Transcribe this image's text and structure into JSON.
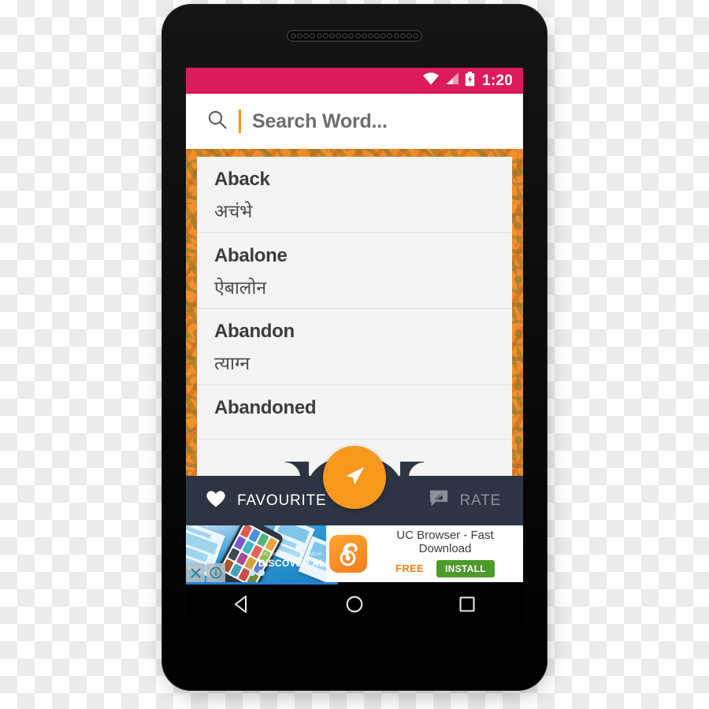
{
  "device": {
    "earpiece_dots": 20
  },
  "status_bar": {
    "time": "1:20",
    "icons": [
      "wifi-icon",
      "signal-icon",
      "battery-charging-icon"
    ],
    "background_color": "#DC1B5B"
  },
  "search": {
    "icon": "search-icon",
    "placeholder": "Search Word...",
    "value": "",
    "caret_color": "#F7941E"
  },
  "word_list": [
    {
      "english": "Aback",
      "hindi": "अचंभे"
    },
    {
      "english": "Abalone",
      "hindi": "ऐबालोन"
    },
    {
      "english": "Abandon",
      "hindi": "त्याग्न"
    },
    {
      "english": "Abandoned",
      "hindi": ""
    }
  ],
  "bottom_bar": {
    "favourite_label": "FAVOURITE",
    "favourite_icon": "heart-icon",
    "rate_label": "RATE",
    "rate_icon": "comment-edit-icon",
    "fab_icon": "send-icon",
    "fab_color": "#F8981D",
    "bar_color": "#2E3542"
  },
  "ad": {
    "title": "UC Browser - Fast Download",
    "free_label": "FREE",
    "install_label": "INSTALL",
    "artwork_text": "DISCOVER ALL",
    "artwork_subtext": "UC Browser 10.6 for Android",
    "close_icon": "close-icon",
    "info_icon": "info-icon",
    "logo_icon": "uc-browser-squirrel-icon",
    "install_color": "#4C9A2A",
    "free_color": "#F08019"
  },
  "nav_bar": {
    "back_icon": "back-triangle-icon",
    "home_icon": "home-circle-icon",
    "recents_icon": "recents-square-icon"
  },
  "theme": {
    "pattern_background": "#EE8B2D",
    "pattern_accent": "#967828",
    "card_background": "#F4F4F4"
  }
}
